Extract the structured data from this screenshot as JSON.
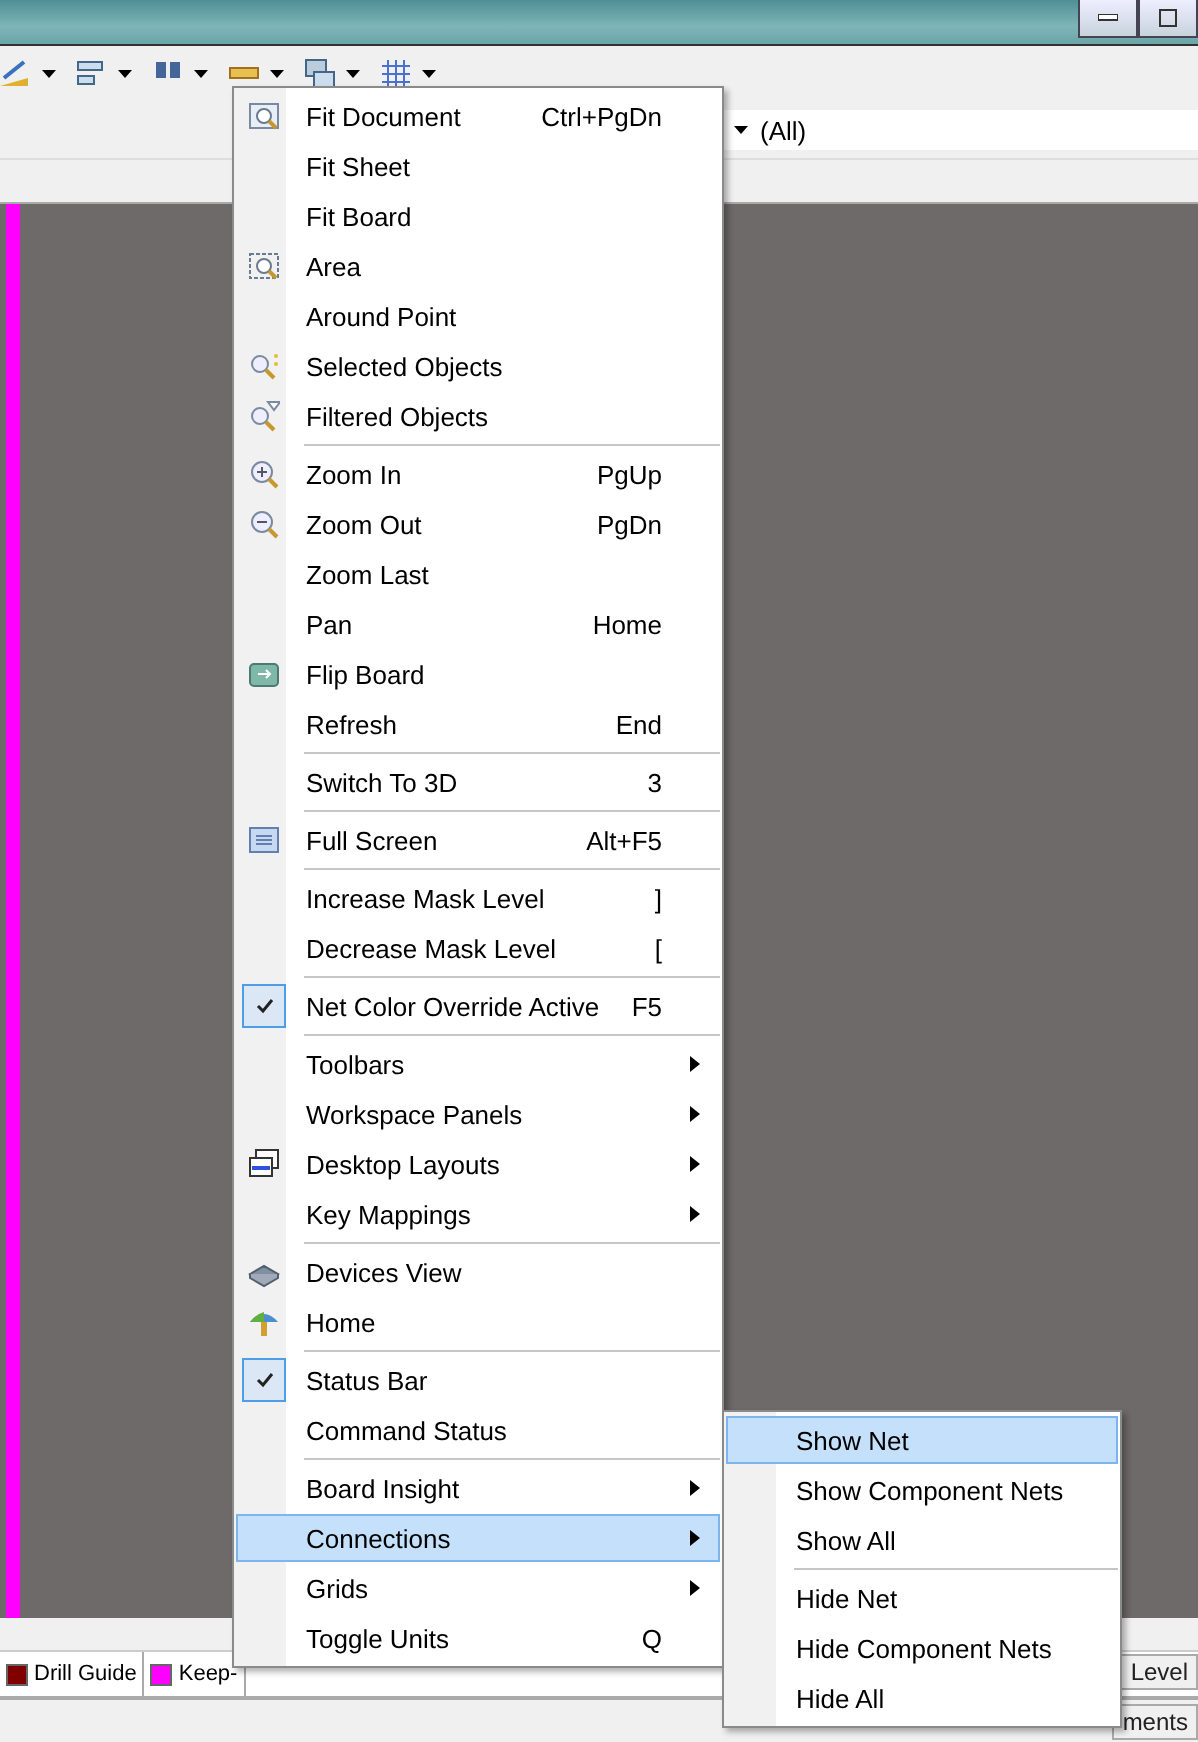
{
  "filter": {
    "value": "(All)"
  },
  "layer_tabs": [
    {
      "label": "Drill Guide",
      "color": "#800000"
    },
    {
      "label": "Keep-",
      "color": "#ff00ff"
    }
  ],
  "right_tabs": [
    "Level",
    "ments"
  ],
  "view_menu": {
    "sections": [
      {
        "items": [
          {
            "label": "Fit Document",
            "shortcut": "Ctrl+PgDn",
            "checked": false,
            "has_submenu": false,
            "selected": false
          },
          {
            "label": "Fit Sheet",
            "checked": false,
            "has_submenu": false,
            "selected": false
          },
          {
            "label": "Fit Board",
            "checked": false,
            "has_submenu": false,
            "selected": false
          },
          {
            "label": "Area",
            "checked": false,
            "has_submenu": false,
            "selected": false
          },
          {
            "label": "Around Point",
            "checked": false,
            "has_submenu": false,
            "selected": false
          },
          {
            "label": "Selected Objects",
            "checked": false,
            "has_submenu": false,
            "selected": false
          },
          {
            "label": "Filtered Objects",
            "checked": false,
            "has_submenu": false,
            "selected": false
          }
        ]
      },
      {
        "items": [
          {
            "label": "Zoom In",
            "shortcut": "PgUp",
            "checked": false,
            "has_submenu": false,
            "selected": false
          },
          {
            "label": "Zoom Out",
            "shortcut": "PgDn",
            "checked": false,
            "has_submenu": false,
            "selected": false
          },
          {
            "label": "Zoom Last",
            "checked": false,
            "has_submenu": false,
            "selected": false
          },
          {
            "label": "Pan",
            "shortcut": "Home",
            "checked": false,
            "has_submenu": false,
            "selected": false
          },
          {
            "label": "Flip Board",
            "checked": false,
            "has_submenu": false,
            "selected": false
          },
          {
            "label": "Refresh",
            "shortcut": "End",
            "checked": false,
            "has_submenu": false,
            "selected": false
          }
        ]
      },
      {
        "items": [
          {
            "label": "Switch To 3D",
            "shortcut": "3",
            "checked": false,
            "has_submenu": false,
            "selected": false
          }
        ]
      },
      {
        "items": [
          {
            "label": "Full Screen",
            "shortcut": "Alt+F5",
            "checked": false,
            "has_submenu": false,
            "selected": false
          }
        ]
      },
      {
        "items": [
          {
            "label": "Increase Mask Level",
            "shortcut": "]",
            "checked": false,
            "has_submenu": false,
            "selected": false
          },
          {
            "label": "Decrease Mask Level",
            "shortcut": "[",
            "checked": false,
            "has_submenu": false,
            "selected": false
          }
        ]
      },
      {
        "items": [
          {
            "label": "Net Color Override Active",
            "shortcut": "F5",
            "checked": true,
            "has_submenu": false,
            "selected": false
          }
        ]
      },
      {
        "items": [
          {
            "label": "Toolbars",
            "checked": false,
            "has_submenu": true,
            "selected": false
          },
          {
            "label": "Workspace Panels",
            "checked": false,
            "has_submenu": true,
            "selected": false
          },
          {
            "label": "Desktop Layouts",
            "checked": false,
            "has_submenu": true,
            "selected": false
          },
          {
            "label": "Key Mappings",
            "checked": false,
            "has_submenu": true,
            "selected": false
          }
        ]
      },
      {
        "items": [
          {
            "label": "Devices View",
            "checked": false,
            "has_submenu": false,
            "selected": false
          },
          {
            "label": "Home",
            "checked": false,
            "has_submenu": false,
            "selected": false
          }
        ]
      },
      {
        "items": [
          {
            "label": "Status Bar",
            "checked": true,
            "has_submenu": false,
            "selected": false
          },
          {
            "label": "Command Status",
            "checked": false,
            "has_submenu": false,
            "selected": false
          }
        ]
      },
      {
        "items": [
          {
            "label": "Board Insight",
            "checked": false,
            "has_submenu": true,
            "selected": false
          },
          {
            "label": "Connections",
            "checked": false,
            "has_submenu": true,
            "selected": true
          },
          {
            "label": "Grids",
            "checked": false,
            "has_submenu": true,
            "selected": false
          },
          {
            "label": "Toggle Units",
            "shortcut": "Q",
            "checked": false,
            "has_submenu": false,
            "selected": false
          }
        ]
      }
    ]
  },
  "connections_menu": {
    "sections": [
      {
        "items": [
          {
            "label": "Show Net",
            "checked": false,
            "has_submenu": false,
            "selected": true
          },
          {
            "label": "Show Component Nets",
            "checked": false,
            "has_submenu": false,
            "selected": false
          },
          {
            "label": "Show All",
            "checked": false,
            "has_submenu": false,
            "selected": false
          }
        ]
      },
      {
        "items": [
          {
            "label": "Hide Net",
            "checked": false,
            "has_submenu": false,
            "selected": false
          },
          {
            "label": "Hide Component Nets",
            "checked": false,
            "has_submenu": false,
            "selected": false
          },
          {
            "label": "Hide All",
            "checked": false,
            "has_submenu": false,
            "selected": false
          }
        ]
      }
    ]
  }
}
